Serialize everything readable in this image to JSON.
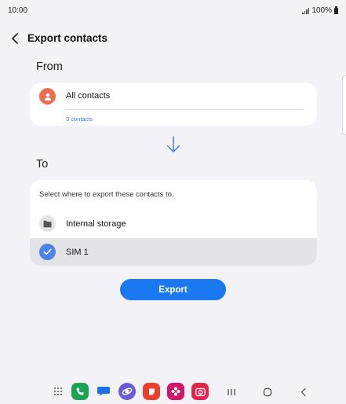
{
  "status_bar": {
    "time": "10:00",
    "battery": "100%"
  },
  "header": {
    "title": "Export contacts"
  },
  "from": {
    "label": "From",
    "source_title": "All contacts",
    "source_count": "3 contacts"
  },
  "to": {
    "label": "To",
    "hint": "Select where to export these contacts to.",
    "options": [
      {
        "label": "Internal storage",
        "icon": "folder-icon",
        "selected": false
      },
      {
        "label": "SIM 1",
        "icon": "check-icon",
        "selected": true
      }
    ]
  },
  "actions": {
    "export_label": "Export"
  },
  "colors": {
    "accent": "#1a78f0",
    "avatar": "#ef6b53",
    "selected_check": "#4c82ec",
    "background": "#f2f2f7"
  },
  "dock": {
    "apps": [
      "apps-grid-icon",
      "phone-app-icon",
      "messages-app-icon",
      "internet-app-icon",
      "notes-app-icon",
      "gallery-app-icon",
      "camera-app-icon"
    ],
    "nav": [
      "recents-icon",
      "home-icon",
      "back-icon"
    ]
  }
}
